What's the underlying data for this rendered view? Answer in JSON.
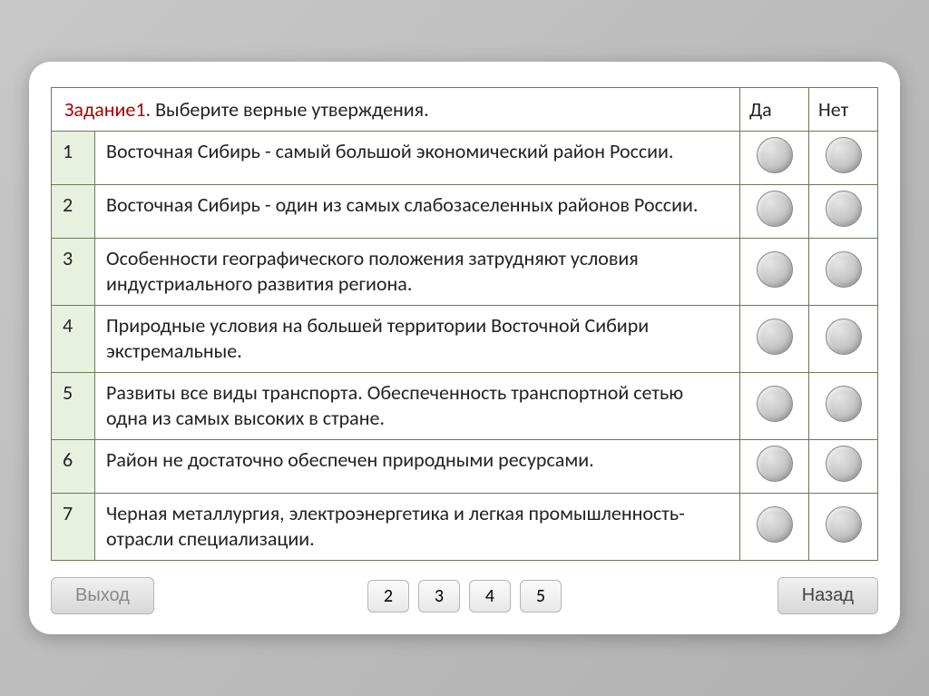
{
  "header": {
    "task_label": "Задание1.",
    "task_title": "Выберите верные утверждения.",
    "yes": "Да",
    "no": "Нет"
  },
  "rows": [
    {
      "num": "1",
      "text": "Восточная Сибирь - самый большой экономический район России."
    },
    {
      "num": "2",
      "text": "Восточная Сибирь - один из самых слабозаселенных районов России."
    },
    {
      "num": "3",
      "text": "Особенности географического положения затрудняют условия индустриального развития региона."
    },
    {
      "num": "4",
      "text": "Природные условия на большей территории Восточной Сибири экстремальные."
    },
    {
      "num": "5",
      "text": "Развиты все виды транспорта. Обеспеченность транспортной сетью одна из самых высоких в стране."
    },
    {
      "num": "6",
      "text": "Район не достаточно обеспечен природными ресурсами."
    },
    {
      "num": "7",
      "text": "Черная металлургия, электроэнергетика и легкая промышленность-отрасли специализации."
    }
  ],
  "footer": {
    "exit": "Выход",
    "back": "Назад",
    "pages": [
      "2",
      "3",
      "4",
      "5"
    ]
  }
}
